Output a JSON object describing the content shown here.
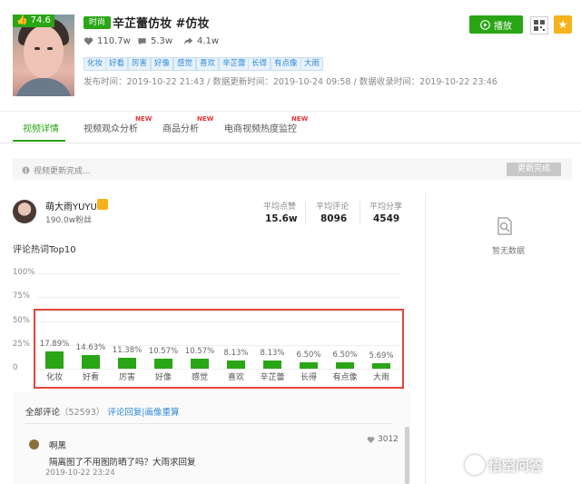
{
  "video": {
    "score": "74.6",
    "category": "时尚",
    "title": "辛芷蕾仿妆 #仿妆",
    "likes": "110.7w",
    "comments": "5.3w",
    "shares": "4.1w",
    "keywords": [
      "化妆",
      "好看",
      "厉害",
      "好像",
      "感觉",
      "喜欢",
      "辛芷蕾",
      "长得",
      "有点像",
      "大雨"
    ],
    "meta": "发布时间：2019-10-22 21:43 / 数据更新时间：2019-10-24 09:58 / 数据收录时间：2019-10-22 23:46",
    "play_label": "播放"
  },
  "tabs": [
    {
      "label": "视频详情",
      "active": true,
      "new": false
    },
    {
      "label": "视频观众分析",
      "active": false,
      "new": true
    },
    {
      "label": "商品分析",
      "active": false,
      "new": true
    },
    {
      "label": "电商视频热度监控",
      "active": false,
      "new": true
    }
  ],
  "new_badge": "NEW",
  "update": {
    "text": "视频更新完成...",
    "button": "更新完成"
  },
  "author": {
    "name": "萌大雨YUYU",
    "fans": "190.0w粉丝",
    "stats": [
      {
        "label": "平均点赞",
        "value": "15.6w"
      },
      {
        "label": "平均评论",
        "value": "8096"
      },
      {
        "label": "平均分享",
        "value": "4549"
      }
    ]
  },
  "right_panel": {
    "empty_text": "暂无数据",
    "icon": "no-data-icon"
  },
  "chart_data": {
    "type": "bar",
    "title": "评论热词Top10",
    "categories": [
      "化妆",
      "好看",
      "厉害",
      "好像",
      "感觉",
      "喜欢",
      "辛芷蕾",
      "长得",
      "有点像",
      "大雨"
    ],
    "values": [
      17.89,
      14.63,
      11.38,
      10.57,
      10.57,
      8.13,
      8.13,
      6.5,
      6.5,
      5.69
    ],
    "value_labels": [
      "17.89%",
      "14.63%",
      "11.38%",
      "10.57%",
      "10.57%",
      "8.13%",
      "8.13%",
      "6.50%",
      "6.50%",
      "5.69%"
    ],
    "yticks": [
      "100%",
      "75%",
      "50%",
      "25%",
      "0"
    ],
    "ylim": [
      0,
      100
    ],
    "color": "#2aa515"
  },
  "comments": {
    "header": "全部评论",
    "count": "（52593）",
    "links": "评论回复|画像重算",
    "items": [
      {
        "user": "啊黑",
        "likes": "3012",
        "text": "隔离图了不用图防晒了吗？大雨求回复",
        "time": "2019-10-22 23:24"
      }
    ]
  },
  "watermark": "悟空问答",
  "colors": {
    "accent": "#2aa515",
    "link": "#2d8cdb",
    "highlight": "#e4443a",
    "star": "#f5b31b"
  }
}
